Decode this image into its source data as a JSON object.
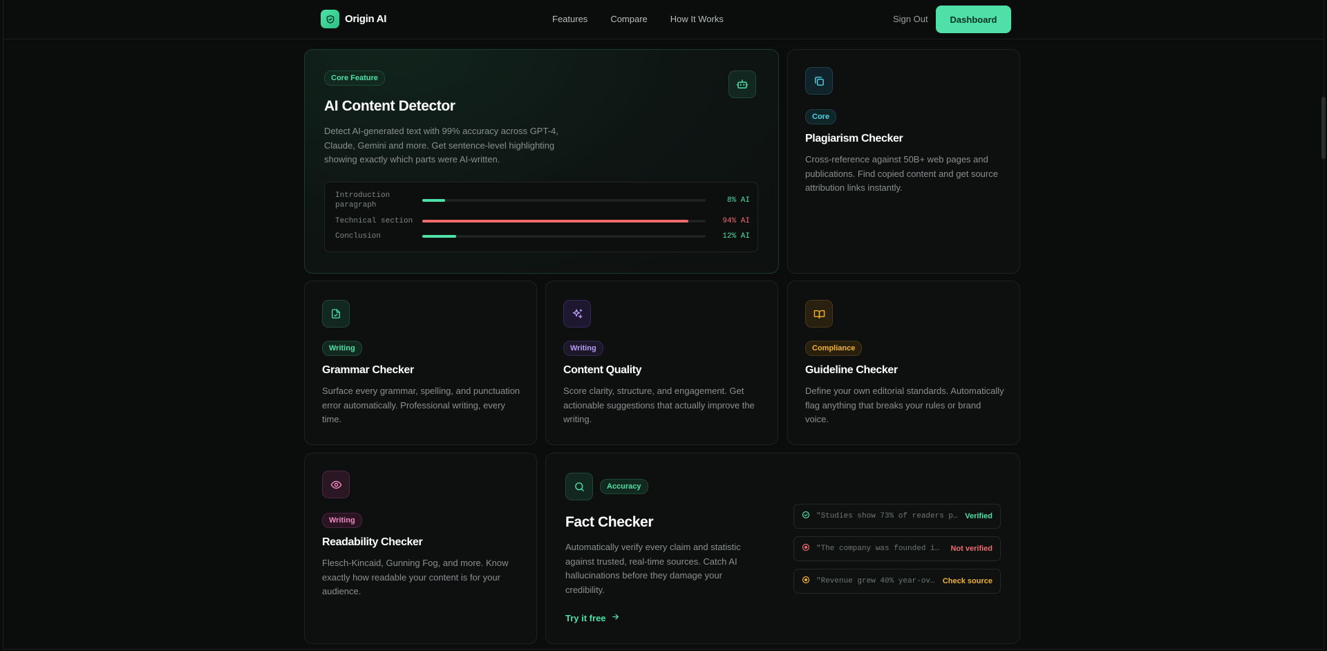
{
  "nav": {
    "brand": "Origin AI",
    "links": [
      "Features",
      "Compare",
      "How It Works"
    ],
    "sign_out": "Sign Out",
    "dashboard": "Dashboard"
  },
  "hero": {
    "badge": "Core Feature",
    "title": "AI Content Detector",
    "description": "Detect AI-generated text with 99% accuracy across GPT-4, Claude, Gemini and more. Get sentence-level highlighting showing exactly which parts were AI-written.",
    "icon": "bot-icon",
    "analysis": [
      {
        "label": "Introduction paragraph",
        "percent": 8,
        "result": "8% AI",
        "color": "#4fe0a8"
      },
      {
        "label": "Technical section",
        "percent": 94,
        "result": "94% AI",
        "color": "#f06b6b"
      },
      {
        "label": "Conclusion",
        "percent": 12,
        "result": "12% AI",
        "color": "#4fe0a8"
      }
    ]
  },
  "cards": {
    "plagiarism": {
      "icon": "copy-icon",
      "badge": "Core",
      "title": "Plagiarism Checker",
      "description": "Cross-reference against 50B+ web pages and publications. Find copied content and get source attribution links instantly."
    },
    "grammar": {
      "icon": "file-check-icon",
      "badge": "Writing",
      "title": "Grammar Checker",
      "description": "Surface every grammar, spelling, and punctuation error automatically. Professional writing, every time."
    },
    "quality": {
      "icon": "sparkles-icon",
      "badge": "Writing",
      "title": "Content Quality",
      "description": "Score clarity, structure, and engagement. Get actionable suggestions that actually improve the writing."
    },
    "guideline": {
      "icon": "book-icon",
      "badge": "Compliance",
      "title": "Guideline Checker",
      "description": "Define your own editorial standards. Automatically flag anything that breaks your rules or brand voice."
    },
    "readability": {
      "icon": "eye-icon",
      "badge": "Writing",
      "title": "Readability Checker",
      "description": "Flesch-Kincaid, Gunning Fog, and more. Know exactly how readable your content is for your audience."
    },
    "fact": {
      "icon": "search-icon",
      "badge": "Accuracy",
      "title": "Fact Checker",
      "description": "Automatically verify every claim and statistic against trusted, real-time sources. Catch AI hallucinations before they damage your credibility.",
      "cta": "Try it free",
      "claims": [
        {
          "text": "\"Studies show 73% of readers p…",
          "status": "Verified",
          "color": "#4fe0a8"
        },
        {
          "text": "\"The company was founded i…",
          "status": "Not verified",
          "color": "#f06b6b"
        },
        {
          "text": "\"Revenue grew 40% year-ov…",
          "status": "Check source",
          "color": "#f2b233"
        }
      ]
    }
  }
}
